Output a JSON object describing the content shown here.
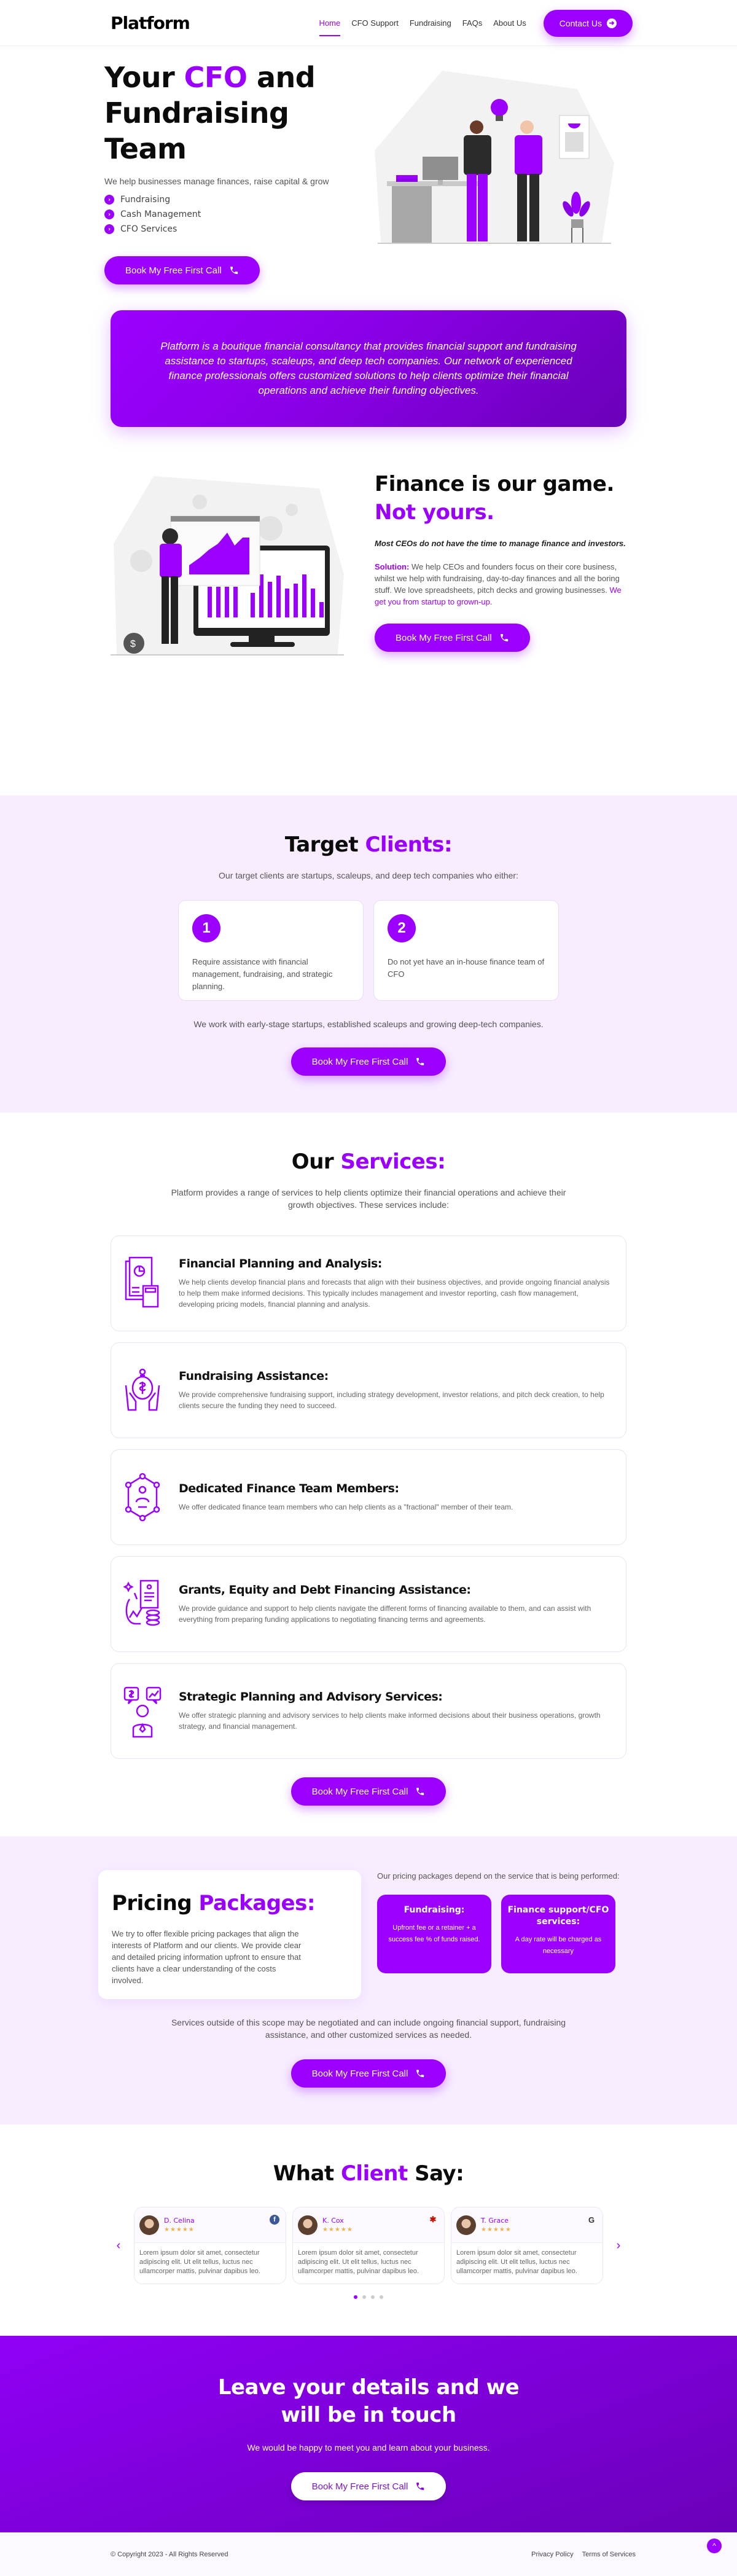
{
  "header": {
    "logo": "Platform",
    "nav": [
      {
        "label": "Home",
        "active": true
      },
      {
        "label": "CFO Support"
      },
      {
        "label": "Fundraising"
      },
      {
        "label": "FAQs"
      },
      {
        "label": "About Us"
      }
    ],
    "contact_label": "Contact Us"
  },
  "cta_label": "Book My Free First Call",
  "hero": {
    "title_pre": "Your ",
    "title_accent": "CFO",
    "title_post": " and Fundraising Team",
    "subtitle": "We help businesses manage finances, raise capital & grow",
    "checklist": [
      "Fundraising",
      "Cash Management",
      "CFO Services"
    ]
  },
  "about": {
    "text": "Platform is a boutique financial consultancy that provides financial support and fundraising assistance to startups, scaleups, and deep tech companies. Our network of experienced finance professionals offers customized solutions to help clients optimize their financial operations and achieve their funding objectives."
  },
  "game": {
    "title_line1": "Finance is our game.",
    "title_line2": "Not yours.",
    "lead": "Most CEOs do not have the time to manage finance and investors.",
    "solution_label": "Solution:",
    "solution_text": " We help CEOs and founders focus on their core business, whilst we help with fundraising, day-to-day finances and all the boring stuff. We love spreadsheets, pitch decks and growing businesses. ",
    "solution_highlight": "We get you from startup to grown-up."
  },
  "clients": {
    "title_pre": "Target ",
    "title_accent": "Clients:",
    "intro": "Our target clients are startups, scaleups, and deep tech companies who either:",
    "cards": [
      {
        "num": "1",
        "text": "Require assistance with financial management, fundraising, and strategic planning."
      },
      {
        "num": "2",
        "text": "Do not yet have an in-house finance team of CFO"
      }
    ],
    "note": "We work with early-stage startups, established scaleups and growing deep-tech companies."
  },
  "services": {
    "title_pre": "Our ",
    "title_accent": "Services:",
    "intro": "Platform provides a range of services to help clients optimize their financial operations and achieve their growth objectives. These services include:",
    "items": [
      {
        "icon": "financial-report-calculator-icon",
        "title": "Financial Planning and Analysis:",
        "text": "We help clients develop financial plans and forecasts that align with their business objectives, and provide ongoing financial analysis to help them make informed decisions. This typically includes management and investor reporting, cash flow management, developing pricing models, financial planning and analysis."
      },
      {
        "icon": "money-bag-hands-icon",
        "title": "Fundraising Assistance:",
        "text": "We provide comprehensive fundraising support, including strategy development, investor relations, and pitch deck creation, to help clients secure the funding they need to succeed."
      },
      {
        "icon": "team-network-icon",
        "title": "Dedicated Finance Team Members:",
        "text": "We offer dedicated finance team members who can help clients as a \"fractional\" member of their team."
      },
      {
        "icon": "grants-equity-debt-icon",
        "title": "Grants, Equity and Debt Financing Assistance:",
        "text": "We provide guidance and support to help clients navigate the different forms of financing available to them, and can assist with everything from preparing funding applications to negotiating financing terms and agreements."
      },
      {
        "icon": "advisor-consulting-icon",
        "title": "Strategic Planning and Advisory Services:",
        "text": "We offer strategic planning and advisory services to help clients make informed decisions about their business operations, growth strategy, and financial management."
      }
    ]
  },
  "pricing": {
    "title_pre": "Pricing ",
    "title_accent": "Packages:",
    "text": "We try to offer flexible pricing packages that align the interests of Platform and our clients. We provide clear and detailed pricing information upfront to ensure that clients have a clear understanding of the costs involved.",
    "intro": "Our pricing packages depend on the service that is being performed:",
    "boxes": [
      {
        "title": "Fundraising:",
        "text": "Upfront fee or a retainer + a success fee % of funds raised."
      },
      {
        "title": "Finance support/CFO services:",
        "text": "A day rate will be charged as necessary"
      }
    ],
    "note": "Services outside of this scope may be negotiated and can include ongoing financial support, fundraising assistance, and other customized services as needed."
  },
  "testimonials": {
    "title_pre": "What ",
    "title_accent": "Client",
    "title_post": " Say:",
    "items": [
      {
        "name": "D. Celina",
        "stars": "★★★★★",
        "source": "facebook",
        "source_glyph": "f",
        "text": "Lorem ipsum dolor sit amet, consectetur adipiscing elit. Ut elit tellus, luctus nec ullamcorper mattis, pulvinar dapibus leo."
      },
      {
        "name": "K. Cox",
        "stars": "★★★★★",
        "source": "yelp",
        "source_glyph": "✱",
        "text": "Lorem ipsum dolor sit amet, consectetur adipiscing elit. Ut elit tellus, luctus nec ullamcorper mattis, pulvinar dapibus leo."
      },
      {
        "name": "T. Grace",
        "stars": "★★★★★",
        "source": "google",
        "source_glyph": "G",
        "text": "Lorem ipsum dolor sit amet, consectetur adipiscing elit. Ut elit tellus, luctus nec ullamcorper mattis, pulvinar dapibus leo."
      }
    ],
    "prev": "‹",
    "next": "›",
    "page_count": 4,
    "active_page": 1
  },
  "cta": {
    "title": "Leave your details and we will be in touch",
    "text": "We would be happy to meet you and learn about your business."
  },
  "footer": {
    "copyright": "© Copyright 2023 - All Rights Reserved",
    "links": [
      "Privacy Policy",
      "Terms of Services"
    ],
    "to_top": "^"
  },
  "colors": {
    "accent": "#9b00ff",
    "light_bg": "#f7edff",
    "star": "#f0b14a"
  }
}
